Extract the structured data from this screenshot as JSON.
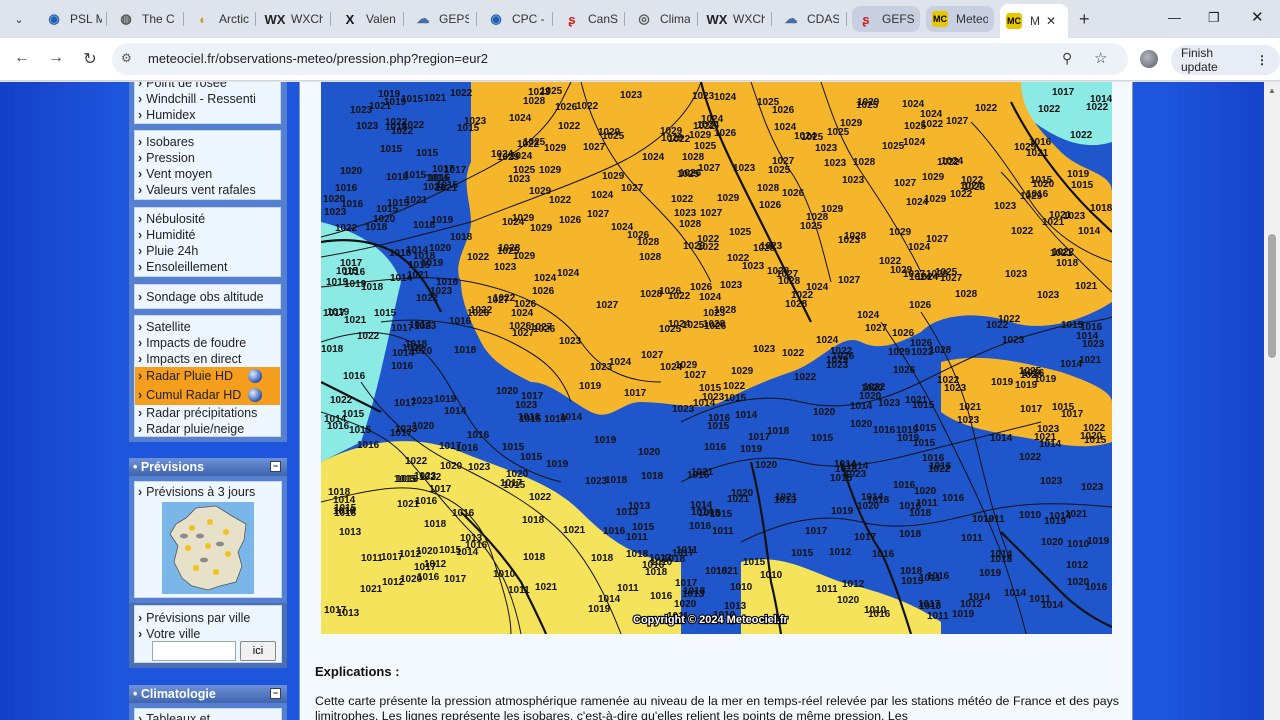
{
  "browser": {
    "tabs": [
      {
        "label": "PSL M",
        "favicon": "noaa-icon",
        "color": "#1a5fb4"
      },
      {
        "label": "The C",
        "favicon": "globe-icon",
        "color": "#555555"
      },
      {
        "label": "Arctic",
        "favicon": "arctic-icon",
        "color": "#c79b3b"
      },
      {
        "label": "WXCh",
        "favicon": "wxcharts-icon",
        "color": "#222222"
      },
      {
        "label": "Valen",
        "favicon": "x-icon",
        "color": "#111111"
      },
      {
        "label": "GEPS",
        "favicon": "cloud-icon",
        "color": "#4a6fa5"
      },
      {
        "label": "CPC -",
        "favicon": "noaa-icon",
        "color": "#1a5fb4"
      },
      {
        "label": "CanSI",
        "favicon": "canada-icon",
        "color": "#d11a1a"
      },
      {
        "label": "Climat",
        "favicon": "climate-icon",
        "color": "#555555"
      },
      {
        "label": "WXCh",
        "favicon": "wxcharts-icon",
        "color": "#222222"
      },
      {
        "label": "CDAS",
        "favicon": "cloud-icon",
        "color": "#4a6fa5"
      },
      {
        "label": "GEFS",
        "favicon": "canada-icon",
        "color": "#d11a1a"
      },
      {
        "label": "Meteo",
        "favicon": "mc-icon",
        "color": "#e6c800"
      },
      {
        "label": "M",
        "favicon": "mc-icon",
        "color": "#e6c800"
      }
    ],
    "mc_text": "MC",
    "url": "meteociel.fr/observations-meteo/pression.php?region=eur2",
    "finish_update": "Finish update"
  },
  "nav": {
    "top_partial": "Point de rosée",
    "group1": [
      "Windchill - Ressenti",
      "Humidex"
    ],
    "group2": [
      "Isobares",
      "Pression",
      "Vent moyen",
      "Valeurs vent rafales"
    ],
    "group3": [
      "Nébulosité",
      "Humidité",
      "Pluie 24h",
      "Ensoleillement"
    ],
    "group4": [
      "Sondage obs altitude"
    ],
    "group5": [
      "Satellite",
      "Impacts de foudre",
      "Impacts en direct",
      "Radar Pluie HD",
      "Cumul Radar HD",
      "Radar précipitations",
      "Radar pluie/neige"
    ]
  },
  "previsions": {
    "title": "• Prévisions",
    "toggle": "−",
    "item": "Prévisions à 3 jours",
    "par_ville": "Prévisions par ville",
    "votre_ville": "Votre ville",
    "input_value": "",
    "button": "ici"
  },
  "climatologie": {
    "title": "• Climatologie",
    "toggle": "−",
    "partial": "Tableaux et"
  },
  "map": {
    "copyright": "Copyright © 2024 Meteociel.fr",
    "colors": {
      "high": "#f6b62c",
      "low": "#1f56cc",
      "mid": "#f5e35c",
      "cyan": "#8ceae4",
      "line": "#111111"
    }
  },
  "explications": {
    "title": "Explications :",
    "text": "Cette carte présente la pression atmosphérique ramenée au niveau de la mer en temps-réel relevée par les stations météo de France et des pays limitrophes. Les lignes représente les isobares, c'est-à-dire qu'elles relient les points de même pression. Les"
  }
}
